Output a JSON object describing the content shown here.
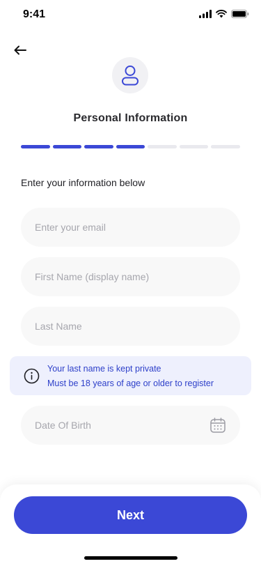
{
  "status_bar": {
    "time": "9:41",
    "icons": [
      "signal-icon",
      "wifi-icon",
      "battery-icon"
    ]
  },
  "header": {
    "back_icon": "arrow-left-icon",
    "avatar_icon": "user-icon",
    "title": "Personal Information"
  },
  "progress": {
    "total_steps": 7,
    "completed_steps": 4,
    "active_color": "#3b48d6",
    "inactive_color": "#e9e9ee"
  },
  "form": {
    "intro": "Enter your information below",
    "email": {
      "value": "",
      "placeholder": "Enter your email"
    },
    "first_name": {
      "value": "",
      "placeholder": "First Name (display name)"
    },
    "last_name": {
      "value": "",
      "placeholder": "Last Name"
    },
    "info": {
      "icon": "info-circle-icon",
      "line1": "Your last name is kept private",
      "line2": "Must be 18 years of age or older to register"
    },
    "dob": {
      "placeholder": "Date Of Birth",
      "icon": "calendar-icon"
    }
  },
  "footer": {
    "next_label": "Next"
  },
  "colors": {
    "accent": "#3b48d6",
    "info_background": "#eef0fd",
    "field_background": "#f8f8f8"
  }
}
